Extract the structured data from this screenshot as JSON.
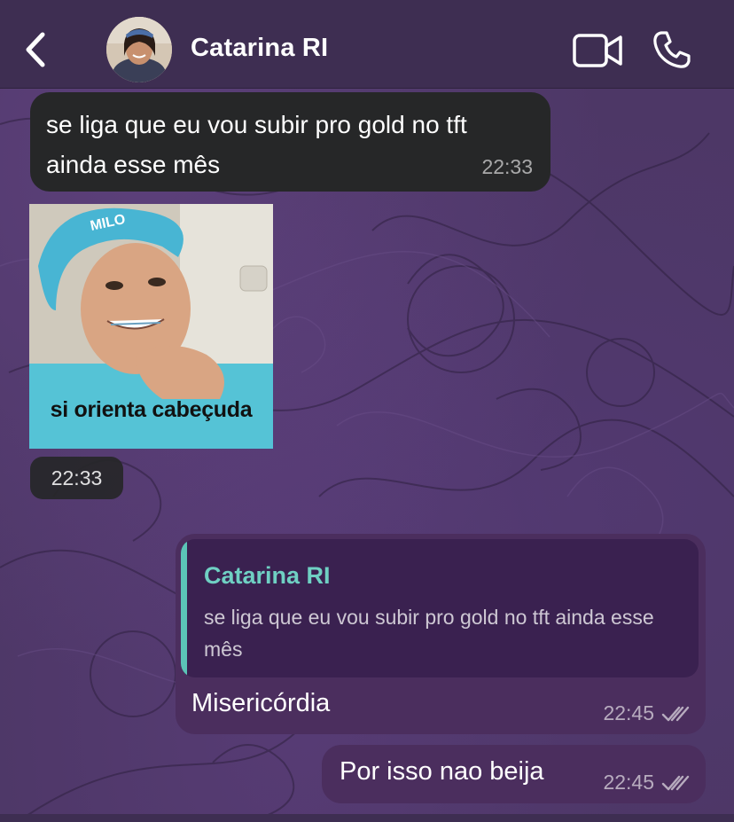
{
  "header": {
    "back_icon": "chevron-left-icon",
    "contact_name": "Catarina RI",
    "video_icon": "video-camera-icon",
    "call_icon": "phone-icon"
  },
  "messages": [
    {
      "direction": "incoming",
      "text": "se liga que eu vou subir pro gold no tft ainda esse mês",
      "time": "22:33"
    },
    {
      "direction": "incoming",
      "type": "sticker",
      "caption": "si orienta cabeçuda",
      "time": "22:33"
    },
    {
      "direction": "outgoing",
      "reply_to": {
        "author": "Catarina RI",
        "text": "se liga que eu vou subir pro gold no tft ainda esse mês"
      },
      "text": "Misericórdia",
      "time": "22:45",
      "status_icon": "double-check-icon"
    },
    {
      "direction": "outgoing",
      "text": "Por isso nao beija",
      "time": "22:45",
      "status_icon": "double-check-icon"
    }
  ],
  "colors": {
    "header_bg": "#3e2e52",
    "incoming_bubble": "#262728",
    "outgoing_bubble": "#4b2e5e",
    "reply_accent": "#5bc4b7"
  }
}
